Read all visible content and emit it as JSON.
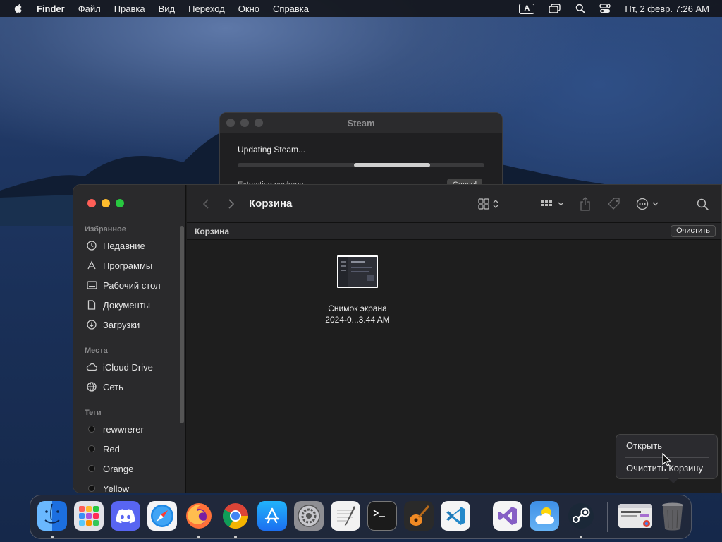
{
  "menubar": {
    "app_name": "Finder",
    "menus": [
      "Файл",
      "Правка",
      "Вид",
      "Переход",
      "Окно",
      "Справка"
    ],
    "input_source": "A",
    "clock": "Пт, 2 февр.  7:26 AM"
  },
  "steam_window": {
    "title": "Steam",
    "status": "Updating Steam...",
    "progress": 0.78,
    "substatus": "Extracting package...",
    "cancel_label": "Cancel"
  },
  "finder": {
    "window_title": "Корзина",
    "path_label": "Корзина",
    "empty_button": "Очистить",
    "sidebar": {
      "favorites_header": "Избранное",
      "favorites": [
        {
          "label": "Недавние",
          "icon": "clock-icon"
        },
        {
          "label": "Программы",
          "icon": "applications-icon"
        },
        {
          "label": "Рабочий стол",
          "icon": "desktop-icon"
        },
        {
          "label": "Документы",
          "icon": "document-icon"
        },
        {
          "label": "Загрузки",
          "icon": "download-icon"
        }
      ],
      "locations_header": "Места",
      "locations": [
        {
          "label": "iCloud Drive",
          "icon": "cloud-icon"
        },
        {
          "label": "Сеть",
          "icon": "network-icon"
        }
      ],
      "tags_header": "Теги",
      "tags": [
        {
          "label": "rewwrerer"
        },
        {
          "label": "Red"
        },
        {
          "label": "Orange"
        },
        {
          "label": "Yellow"
        }
      ]
    },
    "files": [
      {
        "name_line1": "Снимок экрана",
        "name_line2": "2024-0...3.44 AM"
      }
    ]
  },
  "context_menu": {
    "items": [
      "Открыть",
      "Очистить Корзину"
    ]
  },
  "dock": {
    "apps": [
      {
        "name": "Finder",
        "icon": "finder-icon",
        "running": true,
        "color": "#3a8ef6"
      },
      {
        "name": "Launchpad",
        "icon": "launchpad-icon",
        "running": false,
        "color": "#d9d9de"
      },
      {
        "name": "Discord",
        "icon": "discord-icon",
        "running": false,
        "color": "#5865f2"
      },
      {
        "name": "Safari",
        "icon": "safari-icon",
        "running": false,
        "color": "#1e88e5"
      },
      {
        "name": "Firefox",
        "icon": "firefox-icon",
        "running": true,
        "color": "#ff7139"
      },
      {
        "name": "Chrome",
        "icon": "chrome-icon",
        "running": true,
        "color": "#4285f4"
      },
      {
        "name": "App Store",
        "icon": "appstore-icon",
        "running": false,
        "color": "#1c8ef9"
      },
      {
        "name": "System Settings",
        "icon": "settings-icon",
        "running": false,
        "color": "#8e8e93"
      },
      {
        "name": "TextEdit",
        "icon": "textedit-icon",
        "running": false,
        "color": "#f2f2f2"
      },
      {
        "name": "Terminal",
        "icon": "terminal-icon",
        "running": false,
        "color": "#1b1b1b"
      },
      {
        "name": "GarageBand",
        "icon": "garageband-icon",
        "running": false,
        "color": "#f08a24"
      },
      {
        "name": "Visual Studio Code",
        "icon": "vscode-icon",
        "running": false,
        "color": "#2489ca"
      },
      {
        "name": "Visual Studio",
        "icon": "visualstudio-icon",
        "running": false,
        "color": "#865fc5"
      },
      {
        "name": "Weather",
        "icon": "weather-icon",
        "running": false,
        "color": "#3d8fe0"
      },
      {
        "name": "Steam",
        "icon": "steam-icon",
        "running": true,
        "color": "#1b2838"
      },
      {
        "name": "Chrome Window",
        "icon": "chrome-window-icon",
        "running": false,
        "color": "#e8e8e8"
      },
      {
        "name": "Trash",
        "icon": "trash-icon",
        "running": false,
        "color": "#6b6b6b"
      }
    ]
  }
}
